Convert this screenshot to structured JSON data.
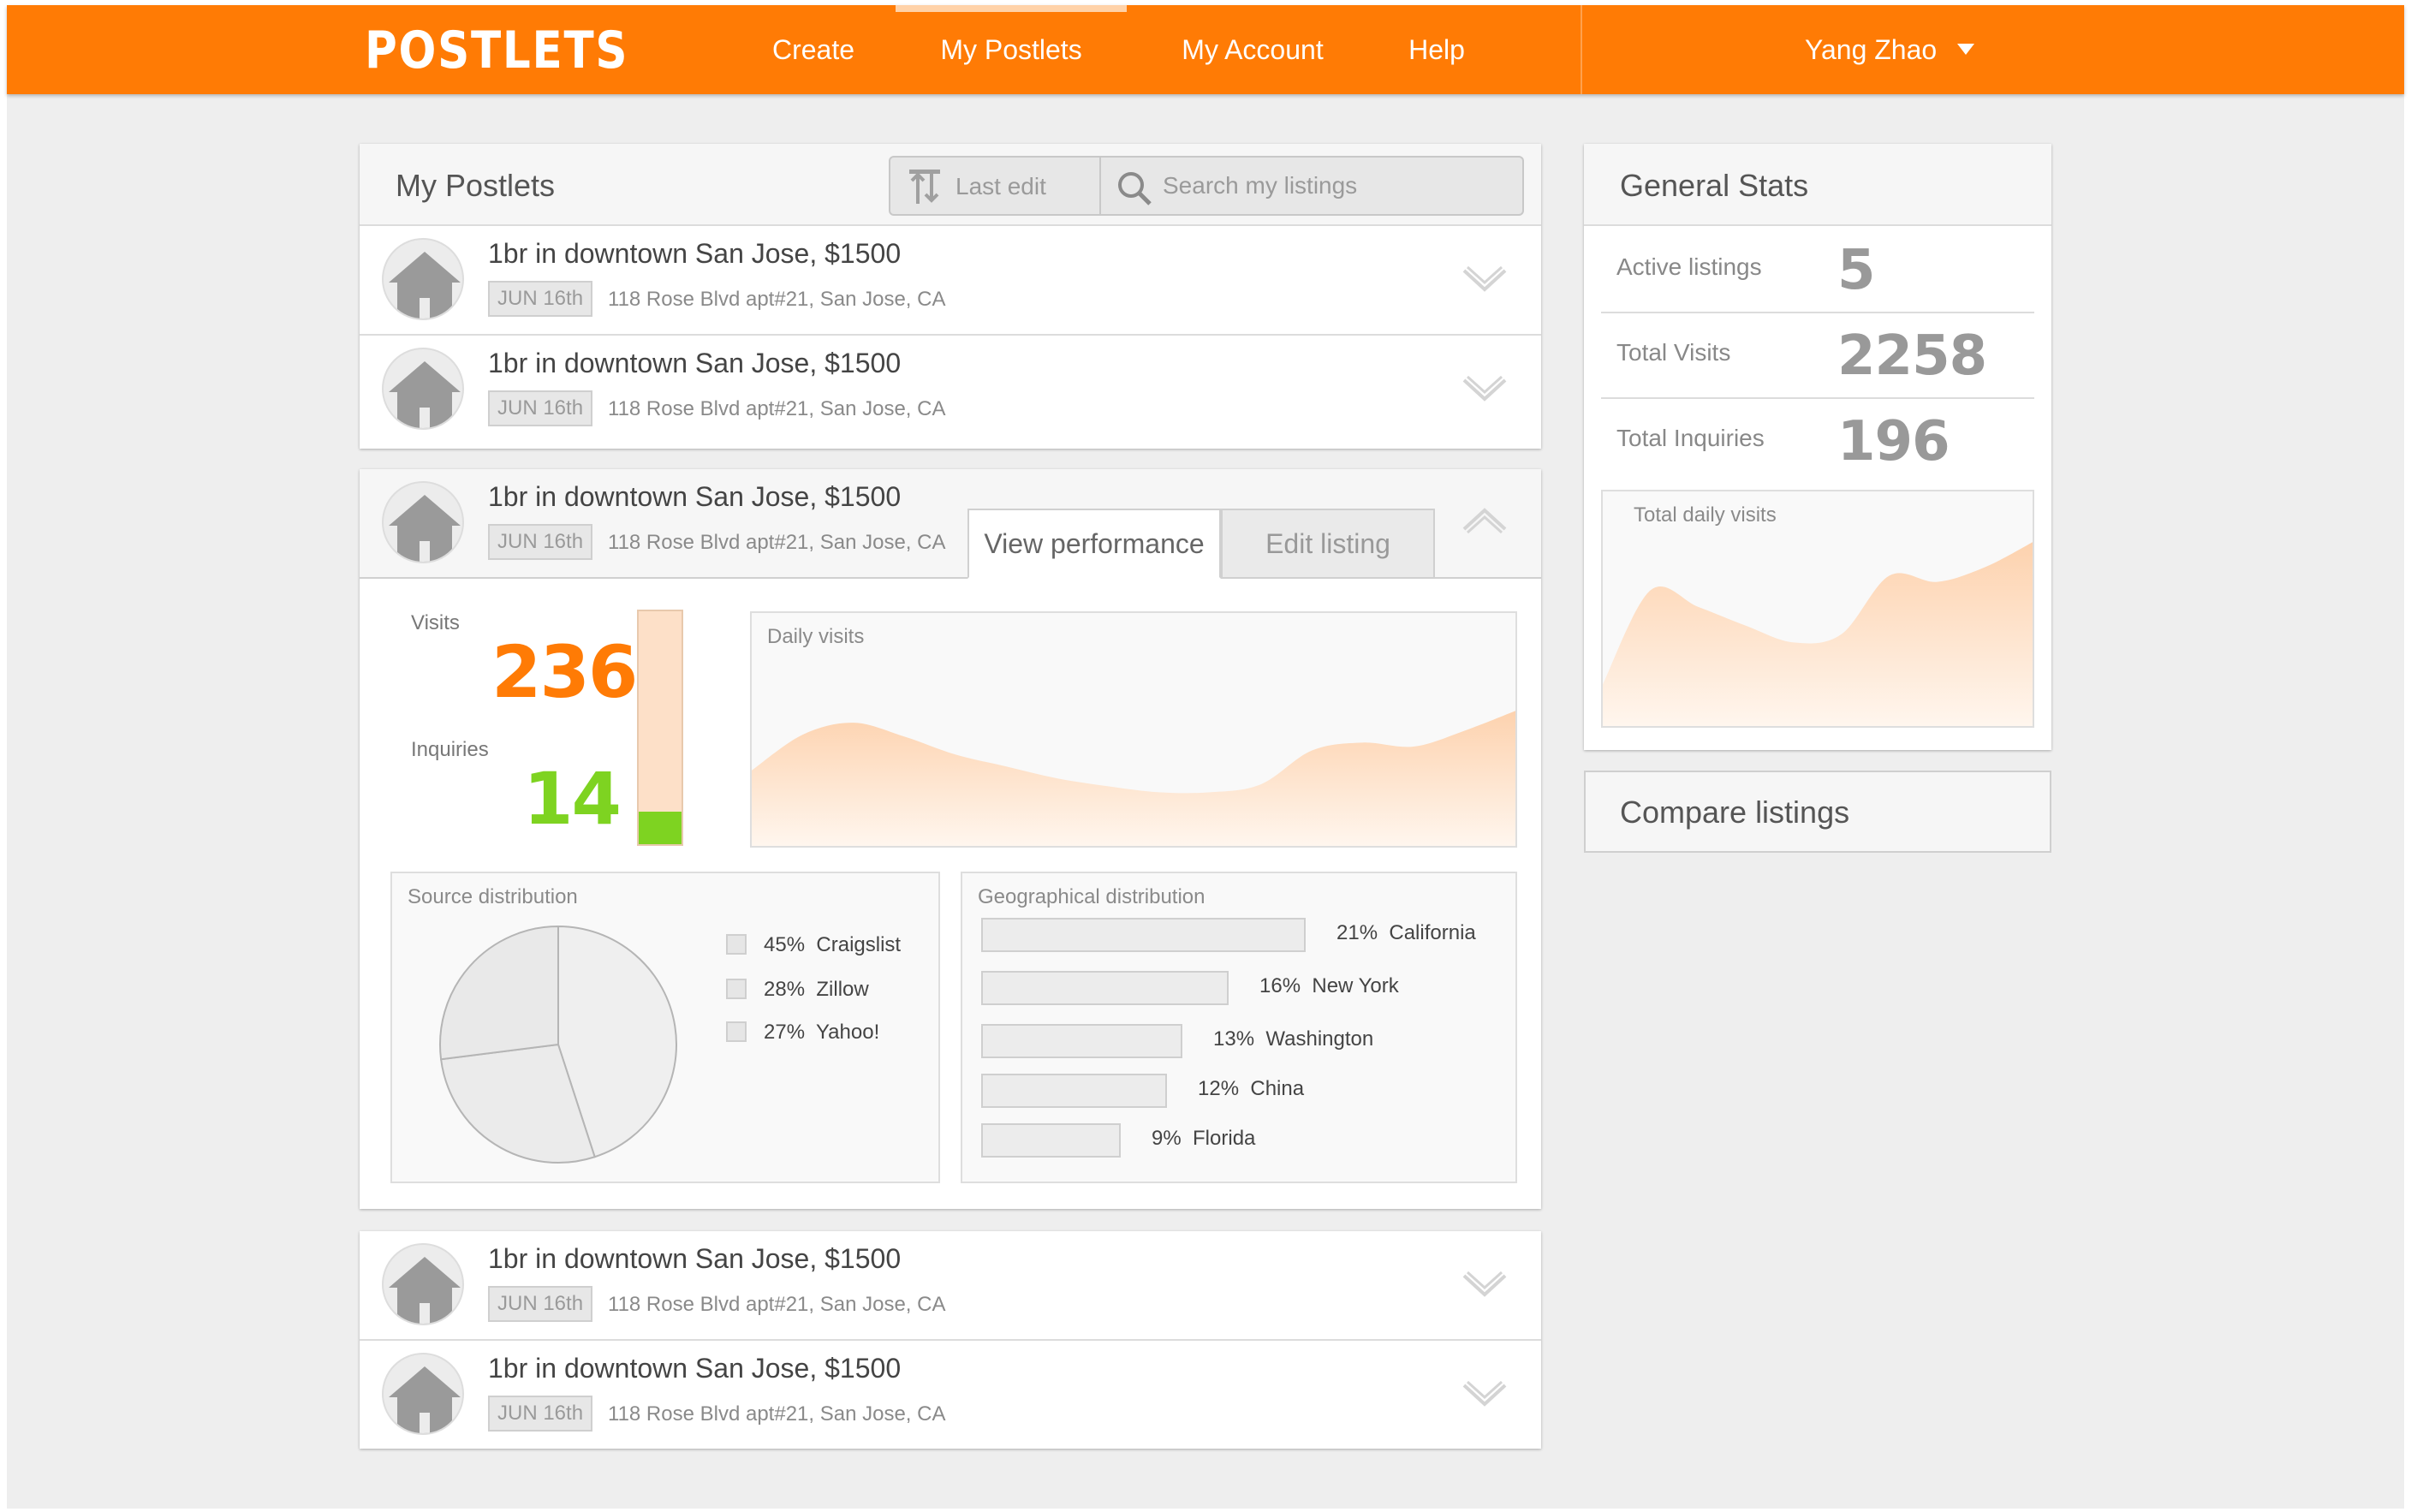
{
  "header": {
    "logo": "POSTLETS",
    "nav": [
      {
        "label": "Create",
        "active": false
      },
      {
        "label": "My Postlets",
        "active": true
      },
      {
        "label": "My Account",
        "active": false
      },
      {
        "label": "Help",
        "active": false
      }
    ],
    "user": "Yang Zhao"
  },
  "postlets": {
    "title": "My Postlets",
    "sort_label": "Last edit",
    "search_placeholder": "Search my listings",
    "listings": [
      {
        "title": "1br in downtown San Jose, $1500",
        "date": "JUN 16th",
        "address": "118 Rose Blvd apt#21, San Jose, CA"
      },
      {
        "title": "1br in downtown San Jose, $1500",
        "date": "JUN 16th",
        "address": "118 Rose Blvd apt#21, San Jose, CA"
      },
      {
        "title": "1br in downtown San Jose, $1500",
        "date": "JUN 16th",
        "address": "118 Rose Blvd apt#21, San Jose, CA"
      },
      {
        "title": "1br in downtown San Jose, $1500",
        "date": "JUN 16th",
        "address": "118 Rose Blvd apt#21, San Jose, CA"
      },
      {
        "title": "1br in downtown San Jose, $1500",
        "date": "JUN 16th",
        "address": "118 Rose Blvd apt#21, San Jose, CA"
      }
    ]
  },
  "expanded": {
    "tabs": [
      "View performance",
      "Edit listing"
    ],
    "active_tab": "View performance",
    "visits_label": "Visits",
    "visits": "236",
    "inquiries_label": "Inquiries",
    "inquiries": "14",
    "inquiry_ratio": 0.14,
    "colors": {
      "visits": "#ff7b05",
      "inquiries": "#7ed321",
      "meter_bg": "#fde0c8"
    },
    "daily_visits_title": "Daily visits",
    "source_title": "Source distribution",
    "geo_title": "Geographical distribution"
  },
  "chart_data": [
    {
      "type": "pie",
      "title": "Source distribution",
      "categories": [
        "Craigslist",
        "Zillow",
        "Yahoo!"
      ],
      "values": [
        45,
        28,
        27
      ],
      "value_labels": [
        "45%",
        "28%",
        "27%"
      ]
    },
    {
      "type": "bar",
      "orientation": "horizontal",
      "title": "Geographical distribution",
      "categories": [
        "California",
        "New York",
        "Washington",
        "China",
        "Florida"
      ],
      "values": [
        21,
        16,
        13,
        12,
        9
      ],
      "value_labels": [
        "21%",
        "16%",
        "13%",
        "12%",
        "9%"
      ]
    },
    {
      "type": "area",
      "title": "Daily visits",
      "smooth": true,
      "values": [
        38,
        56,
        62,
        55,
        46,
        40,
        34,
        30,
        27,
        27,
        31,
        48,
        52,
        50,
        58,
        68
      ],
      "color": "#fdd2ae"
    },
    {
      "type": "area",
      "title": "Total daily visits",
      "smooth": true,
      "values": [
        20,
        65,
        57,
        48,
        40,
        44,
        72,
        69,
        76,
        88
      ],
      "color": "#fdd2ae"
    }
  ],
  "stats": {
    "title": "General Stats",
    "rows": [
      {
        "label": "Active listings",
        "value": "5"
      },
      {
        "label": "Total Visits",
        "value": "2258"
      },
      {
        "label": "Total Inquiries",
        "value": "196"
      }
    ],
    "daily_title": "Total daily visits"
  },
  "compare": {
    "label": "Compare listings"
  },
  "icons": {
    "sort": "sort-icon",
    "search": "search-icon",
    "house": "house-icon",
    "expand": "chevron-down-icon",
    "collapse": "chevron-up-icon",
    "user_menu": "caret-down-icon"
  }
}
